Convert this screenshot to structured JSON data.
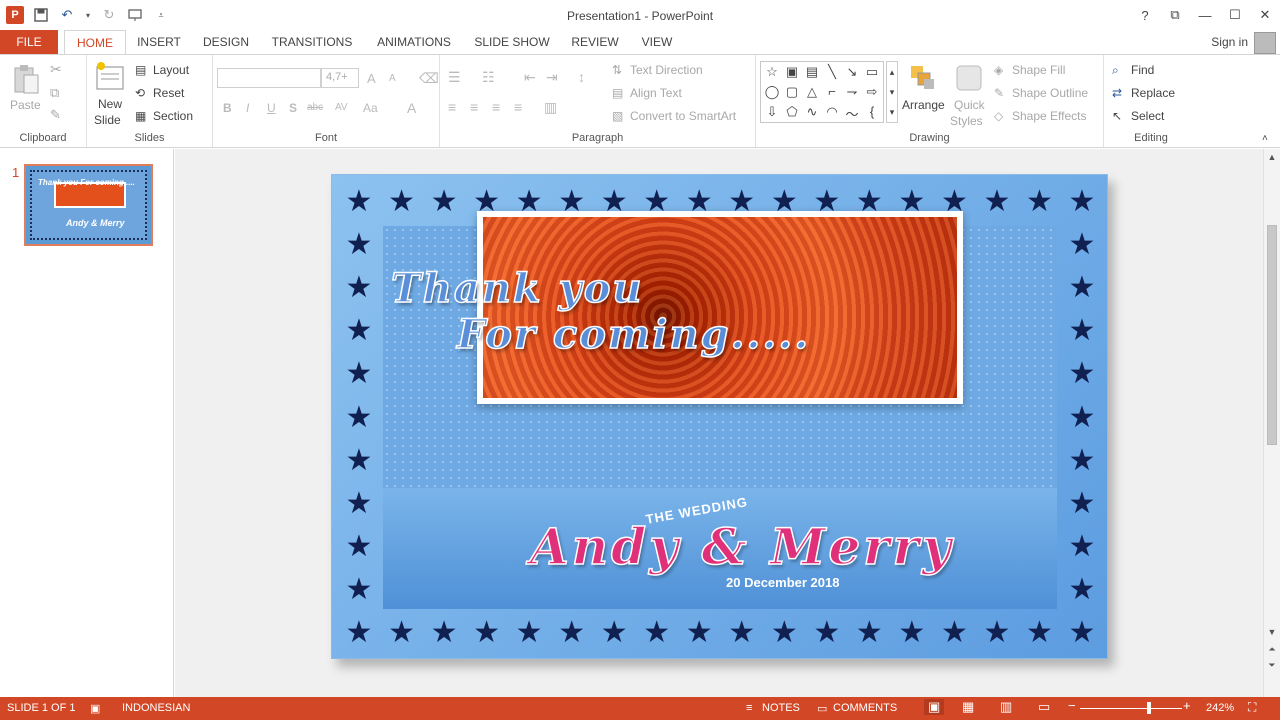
{
  "window": {
    "title": "Presentation1 - PowerPoint",
    "help": "?",
    "ribbon_display": "⧉",
    "minimize": "—",
    "restore": "☐",
    "close": "✕"
  },
  "tabs": [
    "FILE",
    "HOME",
    "INSERT",
    "DESIGN",
    "TRANSITIONS",
    "ANIMATIONS",
    "SLIDE SHOW",
    "REVIEW",
    "VIEW"
  ],
  "account": {
    "sign_in": "Sign in"
  },
  "ribbon": {
    "clipboard": {
      "label": "Clipboard",
      "paste": "Paste"
    },
    "slides": {
      "label": "Slides",
      "new_slide_1": "New",
      "new_slide_2": "Slide",
      "layout": "Layout",
      "reset": "Reset",
      "section": "Section"
    },
    "font": {
      "label": "Font",
      "size": "4,7+",
      "grow": "A",
      "shrink": "A",
      "bold": "B",
      "italic": "I",
      "underline": "U",
      "shadow": "S",
      "strike": "abc",
      "spacing": "AV",
      "case": "Aa",
      "color": "A"
    },
    "paragraph": {
      "label": "Paragraph",
      "text_direction": "Text Direction",
      "align_text": "Align Text",
      "smartart": "Convert to SmartArt"
    },
    "drawing": {
      "label": "Drawing",
      "arrange": "Arrange",
      "quick_styles_1": "Quick",
      "quick_styles_2": "Styles",
      "shape_fill": "Shape Fill",
      "shape_outline": "Shape Outline",
      "shape_effects": "Shape Effects"
    },
    "editing": {
      "label": "Editing",
      "find": "Find",
      "replace": "Replace",
      "select": "Select"
    }
  },
  "thumbnail": {
    "number": "1",
    "text1": "Thank you For coming.....",
    "text2": "Andy & Merry"
  },
  "slide": {
    "line1": "Thank you",
    "line2": "For coming.....",
    "wedding": "THE WEDDING",
    "names": "Andy & Merry",
    "date": "20 December 2018"
  },
  "status": {
    "slide": "SLIDE 1 OF 1",
    "language": "INDONESIAN",
    "notes": "NOTES",
    "comments": "COMMENTS",
    "zoom": "242%",
    "zoom_value": 0.68
  },
  "colors": {
    "accent": "#d24726",
    "star": "#102050",
    "frame": "#6aa9e6"
  }
}
